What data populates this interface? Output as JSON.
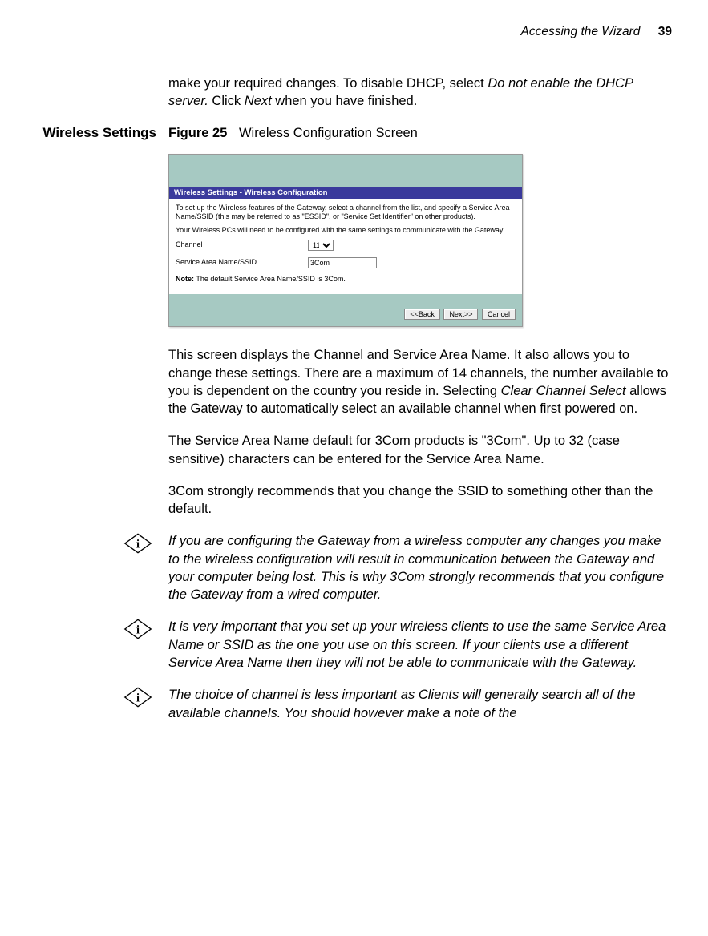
{
  "header": {
    "title": "Accessing the Wizard",
    "page": "39"
  },
  "intro_para": "make your required changes. To disable DHCP, select Do not enable the DHCP server. Click Next when you have finished.",
  "left_heading": "Wireless Settings",
  "figure": {
    "label": "Figure 25",
    "title": "Wireless Configuration Screen"
  },
  "screenshot": {
    "banner": "Wireless Settings - Wireless Configuration",
    "p1": "To set up the Wireless features of the Gateway, select a channel from the list, and specify a Service Area Name/SSID (this may be referred to as \"ESSID\", or \"Service Set Identifier\" on other products).",
    "p2": "Your Wireless PCs will need to be configured with the same settings to communicate with the Gateway.",
    "channel_label": "Channel",
    "channel_value": "11",
    "ssid_label": "Service Area Name/SSID",
    "ssid_value": "3Com",
    "note_label": "Note:",
    "note_text": " The default Service Area Name/SSID is 3Com.",
    "btn_back": "<<Back",
    "btn_next": "Next>>",
    "btn_cancel": "Cancel"
  },
  "body": {
    "p1": "This screen displays the Channel and Service Area Name. It also allows you to change these settings. There are a maximum of 14 channels, the number available to you is dependent on the country you reside in. Selecting Clear Channel Select allows the Gateway to automatically select an available channel when first powered on.",
    "p2": "The Service Area Name default for 3Com products is \"3Com\". Up to 32 (case sensitive) characters can be entered for the Service Area Name.",
    "p3": "3Com strongly recommends that you change the SSID to something other than the default."
  },
  "notes": {
    "n1": "If you are configuring the Gateway from a wireless computer any changes you make to the wireless configuration will result in communication between the Gateway and your computer being lost. This is why 3Com strongly recommends that you configure the Gateway from a wired computer.",
    "n2": "It is very important that you set up your wireless clients to use the same Service Area Name or SSID as the one you use on this screen. If your clients use a different Service Area Name then they will not be able to communicate with the Gateway.",
    "n3": "The choice of channel is less important as Clients will generally search all of the available channels. You should however make a note of the"
  }
}
